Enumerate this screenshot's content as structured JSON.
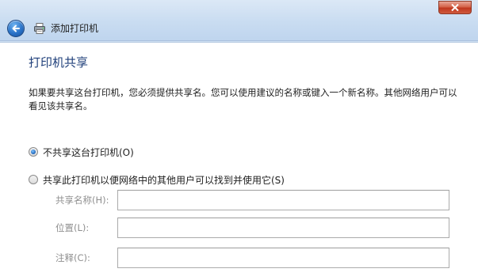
{
  "window": {
    "title": "添加打印机",
    "colors": {
      "accent_heading": "#1f3f7a",
      "titlebar": "#c9dcf1",
      "close_button": "#c0381f"
    }
  },
  "icons": {
    "back": "back-arrow-icon",
    "printer": "printer-icon",
    "close": "close-icon"
  },
  "page": {
    "heading": "打印机共享",
    "description": "如果要共享这台打印机，您必须提供共享名。您可以使用建议的名称或键入一个新名称。其他网络用户可以看见该共享名。"
  },
  "options": {
    "no_share": {
      "label": "不共享这台打印机(O)",
      "checked": true
    },
    "share": {
      "label": "共享此打印机以便网络中的其他用户可以找到并使用它(S)",
      "checked": false
    }
  },
  "fields": {
    "share_name": {
      "label": "共享名称(H):",
      "value": ""
    },
    "location": {
      "label": "位置(L):",
      "value": ""
    },
    "comment": {
      "label": "注释(C):",
      "value": ""
    }
  }
}
